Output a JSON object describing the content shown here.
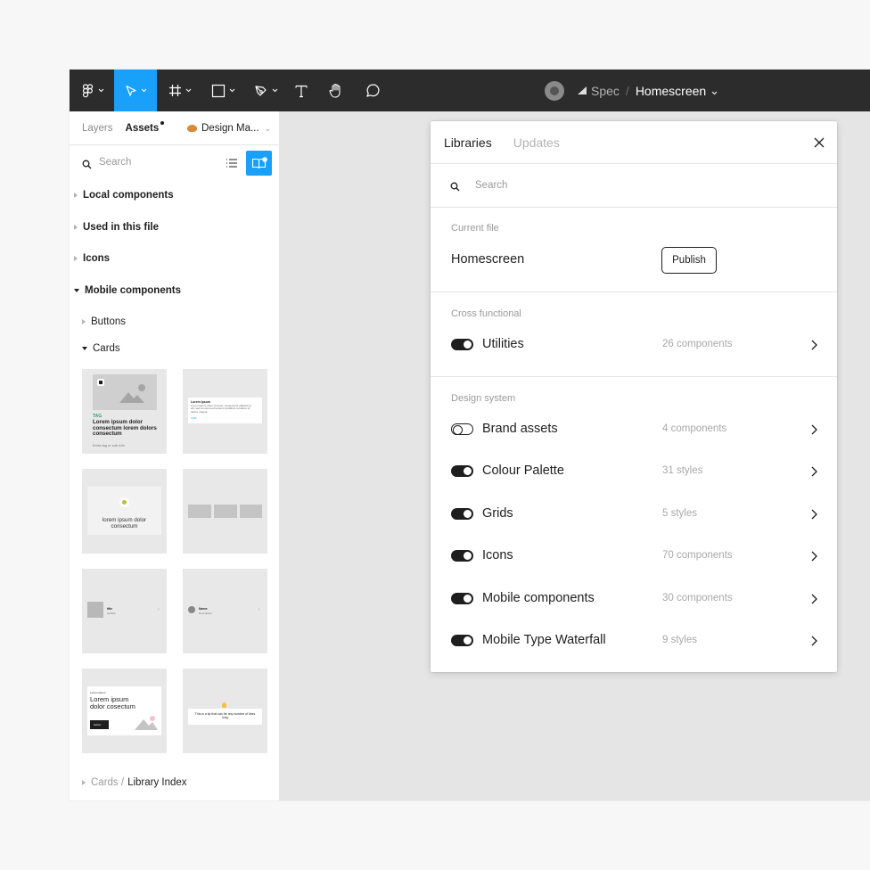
{
  "toolbar": {
    "crumb_spec": "Spec",
    "crumb_sep": "/",
    "file_name": "Homescreen"
  },
  "sidebar": {
    "tabs": [
      "Layers",
      "Assets"
    ],
    "library_tab": "Design Ma...",
    "search_placeholder": "Search",
    "sections": [
      "Local components",
      "Used in this file",
      "Icons",
      "Mobile components"
    ],
    "subsections": [
      "Buttons",
      "Cards"
    ],
    "cards": {
      "card1_tag": "TAG",
      "card1_title": "Lorem ipsum dolor consectum lorem dolors consectum",
      "card1_sub": "Extra tag or sub info",
      "card2_title": "Lorem Ipsum",
      "card2_body": "Lorem ipsum dolor sit amet, consectetur adipiscing elit, sed do eiusmod tempor incididunt ut labore et dolore magna.",
      "card2_link": "LINK",
      "card3_text": "lorem ipsum dolor consectum",
      "card5_title": "title",
      "card5_sub": "subtitle",
      "card6_title": "Name",
      "card6_sub": "Description",
      "card7_over": "Lorem ipsum",
      "card7_title": "Lorem ipsum dolor cosectum",
      "card7_btn": "button",
      "card8_text": "This is a tip that can be any number of lines long"
    },
    "footer_dim": "Cards /",
    "footer_name": "Library Index"
  },
  "panel": {
    "tabs": [
      "Libraries",
      "Updates"
    ],
    "search_placeholder": "Search",
    "current_file_label": "Current file",
    "current_file_name": "Homescreen",
    "publish_label": "Publish",
    "cross_label": "Cross functional",
    "design_label": "Design system",
    "libraries": [
      {
        "name": "Utilities",
        "count": "26 components",
        "enabled": true
      },
      {
        "name": "Brand assets",
        "count": "4 components",
        "enabled": false
      },
      {
        "name": "Colour Palette",
        "count": "31 styles",
        "enabled": true
      },
      {
        "name": "Grids",
        "count": "5 styles",
        "enabled": true
      },
      {
        "name": "Icons",
        "count": "70 components",
        "enabled": true
      },
      {
        "name": "Mobile components",
        "count": "30 components",
        "enabled": true
      },
      {
        "name": "Mobile Type Waterfall",
        "count": "9 styles",
        "enabled": true
      }
    ]
  },
  "colors": {
    "toolbar_bg": "#2c2c2c",
    "accent": "#18a0fb",
    "canvas": "#e5e5e5"
  }
}
